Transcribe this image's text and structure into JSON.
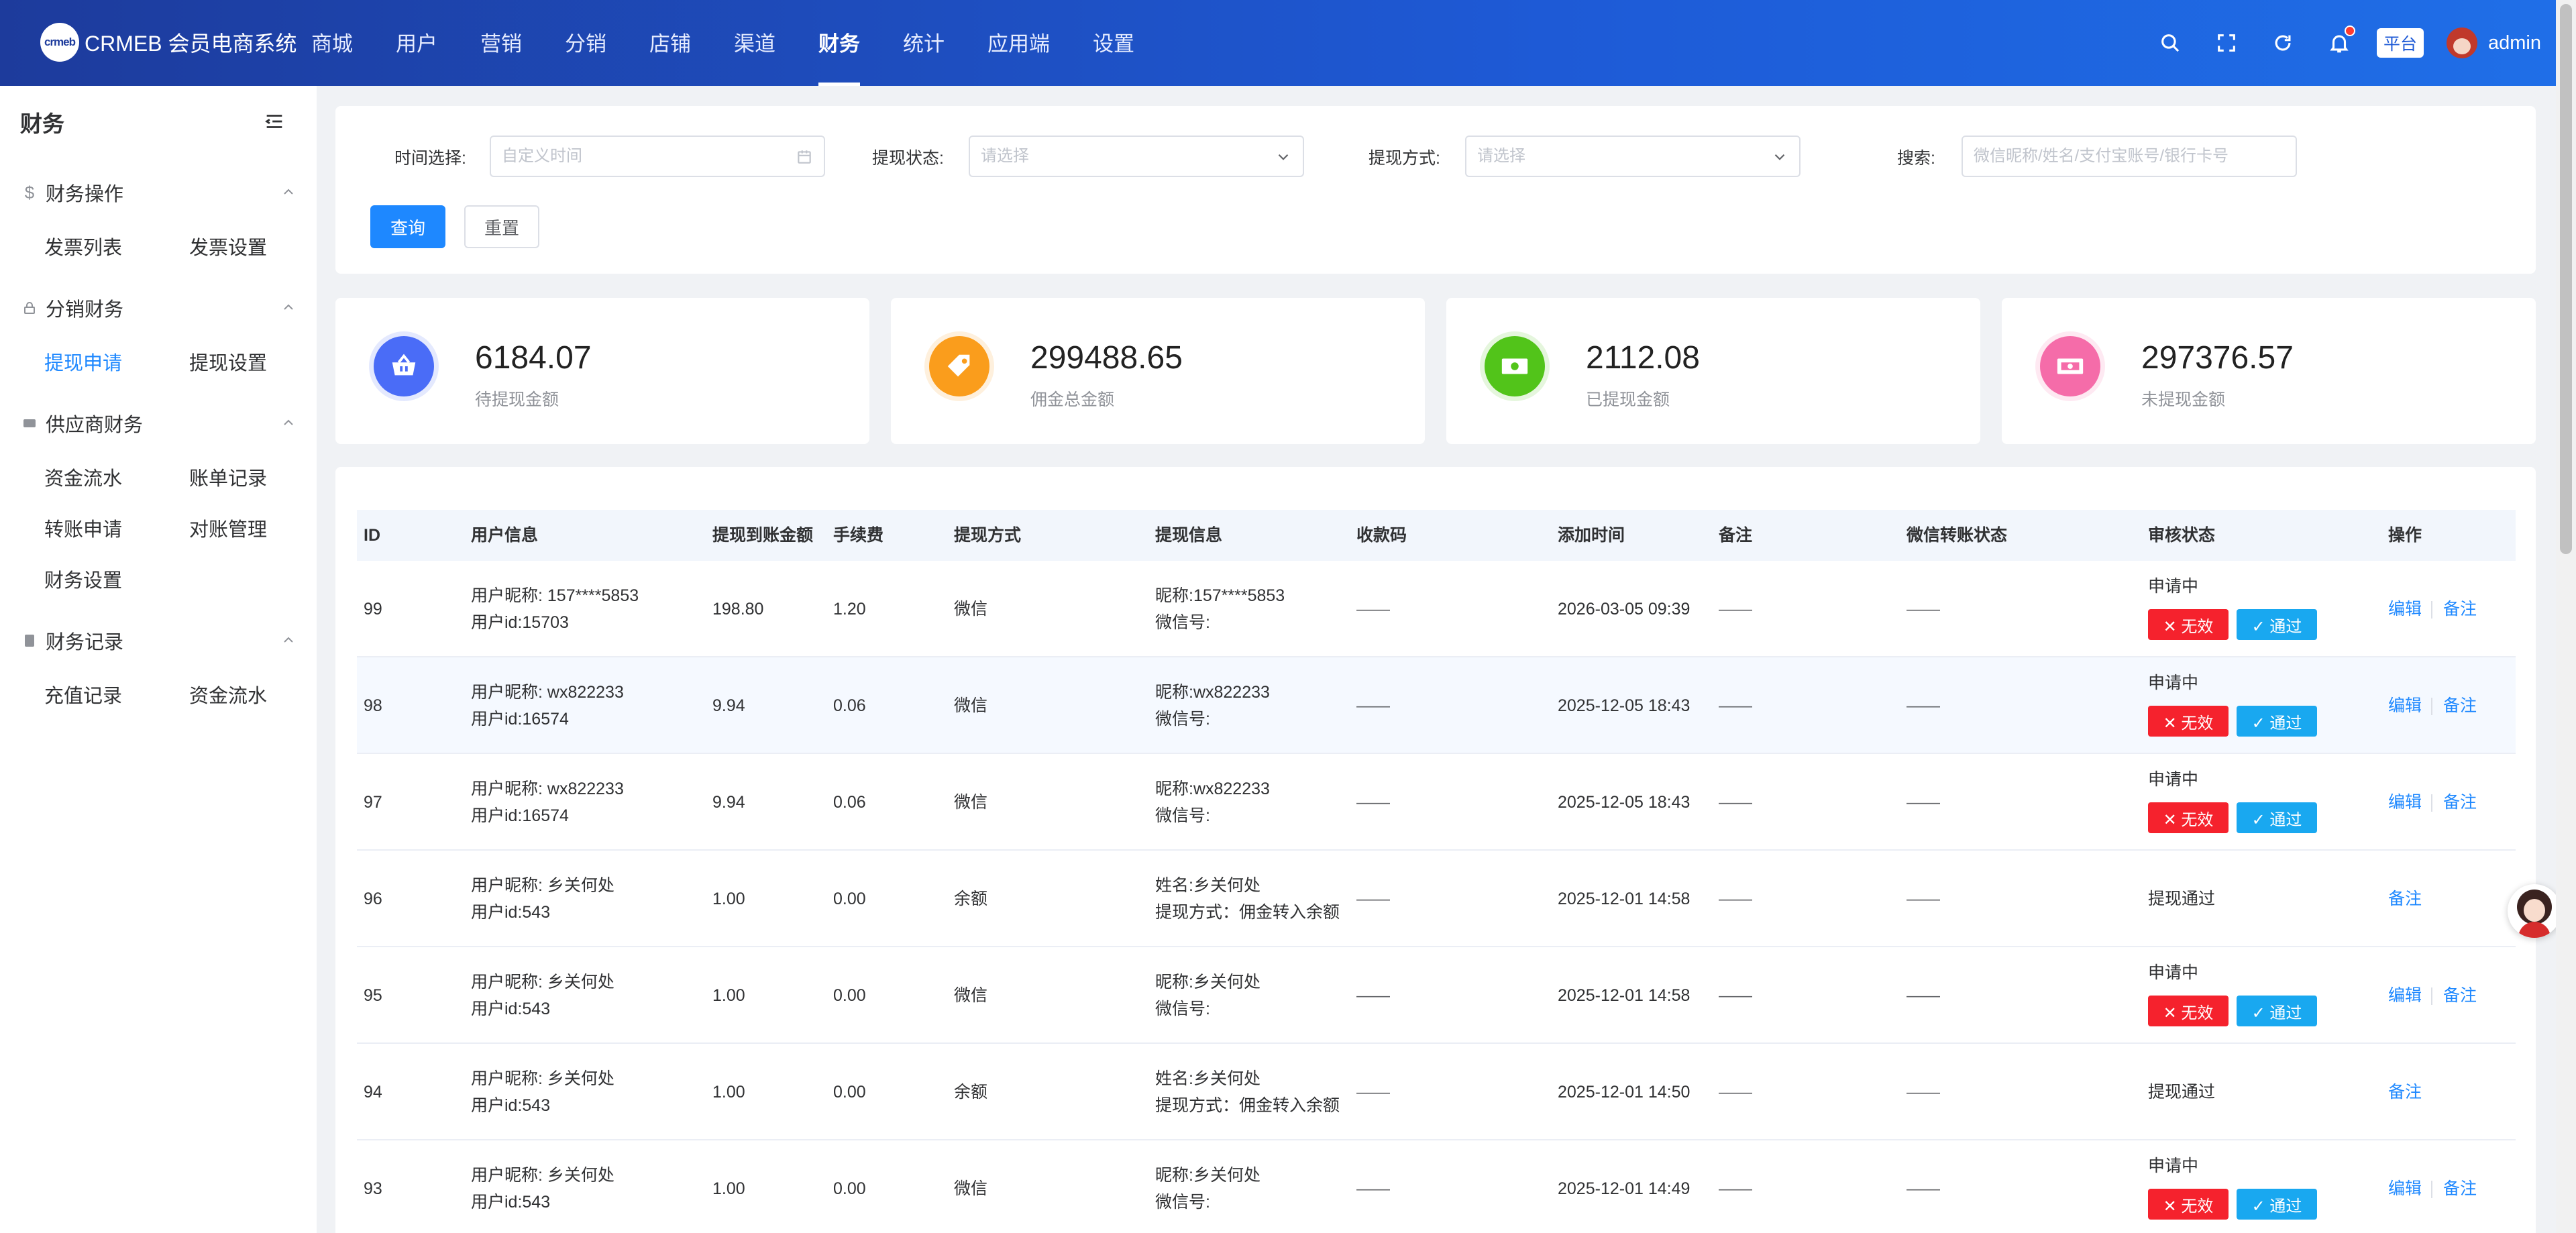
{
  "header": {
    "logo_mark": "crmeb",
    "logo_text": "CRMEB 会员电商系统",
    "nav": [
      "商城",
      "用户",
      "营销",
      "分销",
      "店铺",
      "渠道",
      "财务",
      "统计",
      "应用端",
      "设置"
    ],
    "active_nav": "财务",
    "platform_badge": "平台",
    "username": "admin",
    "icons": [
      "search-icon",
      "fullscreen-icon",
      "refresh-icon",
      "bell-icon"
    ]
  },
  "sidebar": {
    "title": "财务",
    "groups": [
      {
        "label": "财务操作",
        "icon": "dollar-icon",
        "items": [
          "发票列表",
          "发票设置"
        ]
      },
      {
        "label": "分销财务",
        "icon": "lock-icon",
        "items": [
          "提现申请",
          "提现设置"
        ]
      },
      {
        "label": "供应商财务",
        "icon": "card-icon",
        "items": [
          "资金流水",
          "账单记录",
          "转账申请",
          "对账管理",
          "财务设置"
        ]
      },
      {
        "label": "财务记录",
        "icon": "doc-icon",
        "items": [
          "充值记录",
          "资金流水"
        ]
      }
    ],
    "active_item": "提现申请"
  },
  "filters": {
    "time_label": "时间选择:",
    "time_placeholder": "自定义时间",
    "status_label": "提现状态:",
    "status_placeholder": "请选择",
    "method_label": "提现方式:",
    "method_placeholder": "请选择",
    "search_label": "搜索:",
    "search_placeholder": "微信昵称/姓名/支付宝账号/银行卡号",
    "query_button": "查询",
    "reset_button": "重置"
  },
  "stats": [
    {
      "value": "6184.07",
      "label": "待提现金额",
      "color": "#4a6cf7",
      "icon": "basket-icon"
    },
    {
      "value": "299488.65",
      "label": "佣金总金额",
      "color": "#fa9d1c",
      "icon": "tag-icon"
    },
    {
      "value": "2112.08",
      "label": "已提现金额",
      "color": "#52c41a",
      "icon": "cash-icon"
    },
    {
      "value": "297376.57",
      "label": "未提现金额",
      "color": "#f56ca9",
      "icon": "money-icon"
    }
  ],
  "table": {
    "columns": [
      "ID",
      "用户信息",
      "提现到账金额",
      "手续费",
      "提现方式",
      "提现信息",
      "收款码",
      "添加时间",
      "备注",
      "微信转账状态",
      "审核状态",
      "操作"
    ],
    "rows": [
      {
        "id": "99",
        "nick": "用户昵称: 157****5853",
        "uid": "用户id:15703",
        "amount": "198.80",
        "fee": "1.20",
        "method": "微信",
        "info1": "昵称:157****5853",
        "info2": "微信号:",
        "qr": "——",
        "time": "2026-03-05 09:39",
        "remark": "——",
        "wx_status": "——",
        "audit": "申请中",
        "pending": true
      },
      {
        "id": "98",
        "nick": "用户昵称: wx822233",
        "uid": "用户id:16574",
        "amount": "9.94",
        "fee": "0.06",
        "method": "微信",
        "info1": "昵称:wx822233",
        "info2": "微信号:",
        "qr": "——",
        "time": "2025-12-05 18:43",
        "remark": "——",
        "wx_status": "——",
        "audit": "申请中",
        "pending": true
      },
      {
        "id": "97",
        "nick": "用户昵称: wx822233",
        "uid": "用户id:16574",
        "amount": "9.94",
        "fee": "0.06",
        "method": "微信",
        "info1": "昵称:wx822233",
        "info2": "微信号:",
        "qr": "——",
        "time": "2025-12-05 18:43",
        "remark": "——",
        "wx_status": "——",
        "audit": "申请中",
        "pending": true
      },
      {
        "id": "96",
        "nick": "用户昵称: 乡关何处",
        "uid": "用户id:543",
        "amount": "1.00",
        "fee": "0.00",
        "method": "余额",
        "info1": "姓名:乡关何处",
        "info2": "提现方式：佣金转入余额",
        "qr": "——",
        "time": "2025-12-01 14:58",
        "remark": "——",
        "wx_status": "——",
        "audit": "提现通过",
        "pending": false
      },
      {
        "id": "95",
        "nick": "用户昵称: 乡关何处",
        "uid": "用户id:543",
        "amount": "1.00",
        "fee": "0.00",
        "method": "微信",
        "info1": "昵称:乡关何处",
        "info2": "微信号:",
        "qr": "——",
        "time": "2025-12-01 14:58",
        "remark": "——",
        "wx_status": "——",
        "audit": "申请中",
        "pending": true
      },
      {
        "id": "94",
        "nick": "用户昵称: 乡关何处",
        "uid": "用户id:543",
        "amount": "1.00",
        "fee": "0.00",
        "method": "余额",
        "info1": "姓名:乡关何处",
        "info2": "提现方式：佣金转入余额",
        "qr": "——",
        "time": "2025-12-01 14:50",
        "remark": "——",
        "wx_status": "——",
        "audit": "提现通过",
        "pending": false
      },
      {
        "id": "93",
        "nick": "用户昵称: 乡关何处",
        "uid": "用户id:543",
        "amount": "1.00",
        "fee": "0.00",
        "method": "微信",
        "info1": "昵称:乡关何处",
        "info2": "微信号:",
        "qr": "——",
        "time": "2025-12-01 14:49",
        "remark": "——",
        "wx_status": "——",
        "audit": "申请中",
        "pending": true
      }
    ],
    "reject_label": "✕ 无效",
    "approve_label": "✓ 通过",
    "edit_label": "编辑",
    "note_label": "备注"
  }
}
